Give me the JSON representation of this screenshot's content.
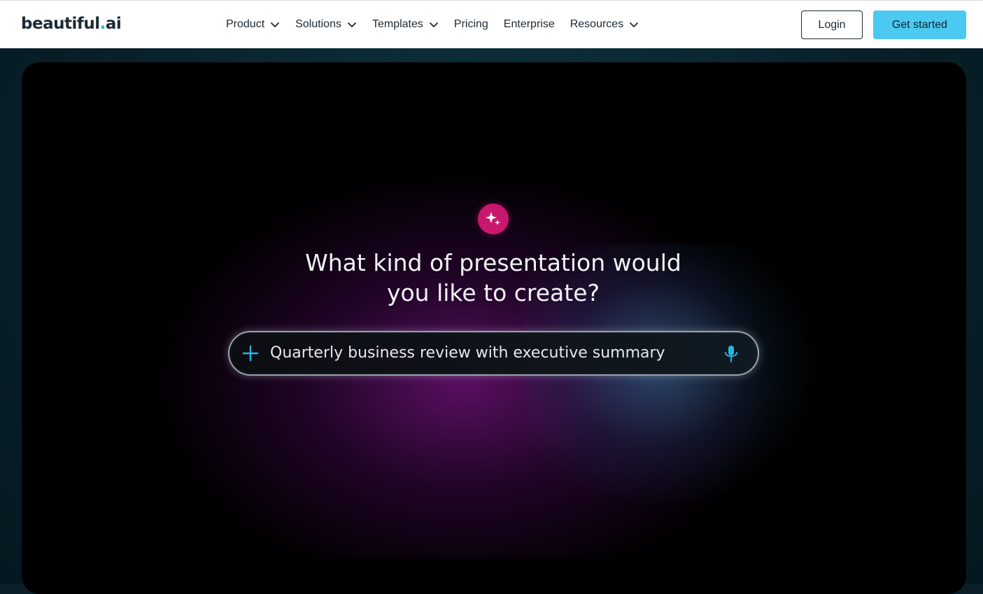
{
  "logo": {
    "text": "beautiful",
    "dot": ".",
    "suffix": "ai"
  },
  "nav": {
    "items": [
      {
        "label": "Product",
        "has_dropdown": true
      },
      {
        "label": "Solutions",
        "has_dropdown": true
      },
      {
        "label": "Templates",
        "has_dropdown": true
      },
      {
        "label": "Pricing",
        "has_dropdown": false
      },
      {
        "label": "Enterprise",
        "has_dropdown": false
      },
      {
        "label": "Resources",
        "has_dropdown": true
      }
    ],
    "login_label": "Login",
    "cta_label": "Get started"
  },
  "hero": {
    "icon": "sparkle-icon",
    "headline_line1": "What kind of presentation would",
    "headline_line2": "you like to create?",
    "prompt": {
      "value": "Quarterly business review with executive summary",
      "left_icon": "plus-icon",
      "right_icon": "microphone-icon"
    }
  },
  "colors": {
    "accent": "#4cc9f0",
    "brand_dark": "#1b2a36",
    "logo_dot": "#2bb5e0",
    "sparkle_bg": "#c8186e",
    "prompt_icon": "#2bb5e0"
  }
}
